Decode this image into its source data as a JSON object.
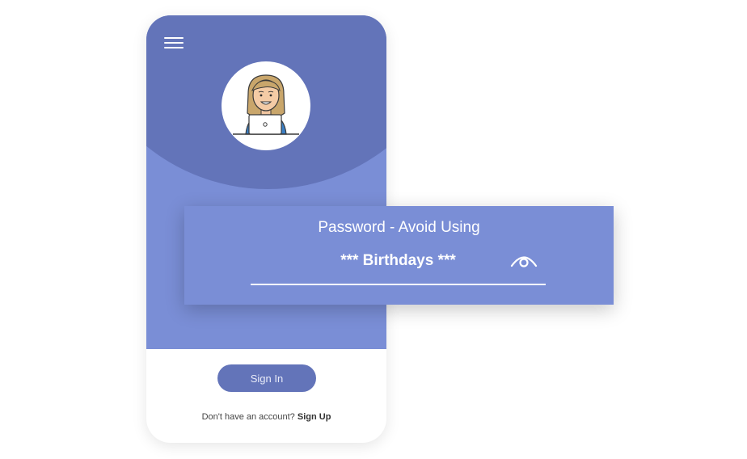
{
  "colors": {
    "accent_dark": "#6374b9",
    "accent_light": "#7a8ed6",
    "background": "#ffffff"
  },
  "icons": {
    "menu": "hamburger-menu-icon",
    "avatar": "person-with-laptop-illustration",
    "visibility": "eye-icon"
  },
  "password_field": {
    "label": "Password - Avoid Using",
    "value": "*** Birthdays ***"
  },
  "signin": {
    "button_label": "Sign In",
    "prompt": "Don't have an account?",
    "signup_label": "Sign Up"
  }
}
